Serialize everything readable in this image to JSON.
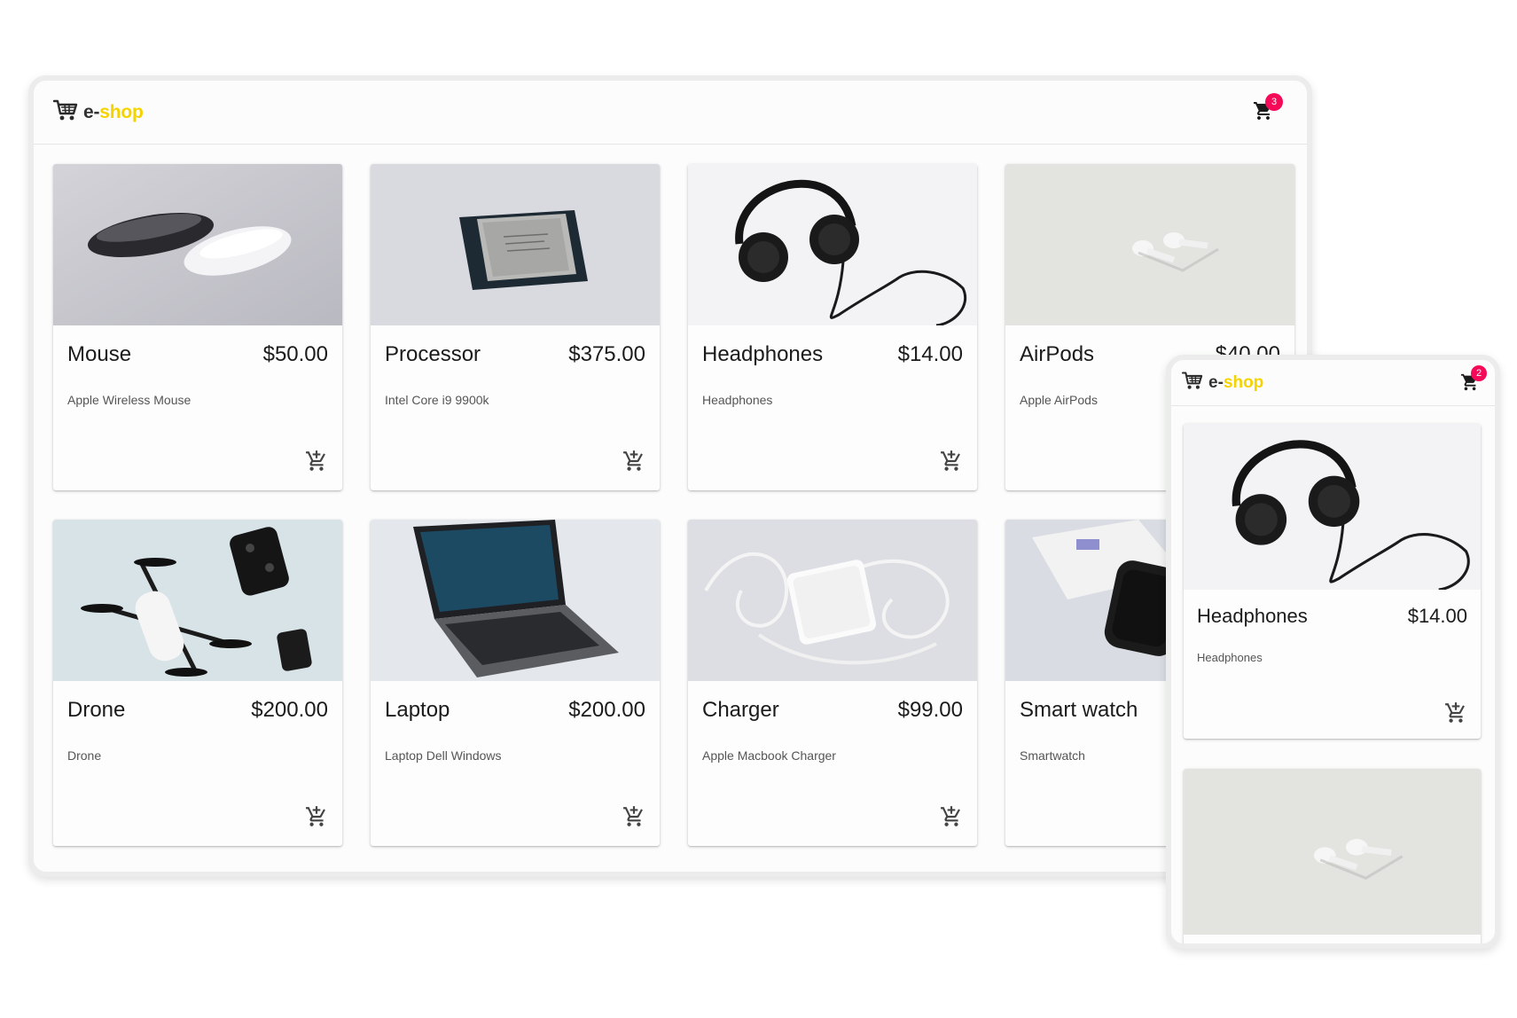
{
  "desktop": {
    "brand": {
      "prefix": "e-",
      "suffix": "shop",
      "icon": "shopping-cart-logo-icon"
    },
    "cart": {
      "icon": "cart-icon",
      "count": "3"
    },
    "products": [
      {
        "name": "Mouse",
        "price": "$50.00",
        "description": "Apple Wireless Mouse",
        "image": "mouse-photo"
      },
      {
        "name": "Processor",
        "price": "$375.00",
        "description": "Intel Core i9 9900k",
        "image": "processor-photo"
      },
      {
        "name": "Headphones",
        "price": "$14.00",
        "description": "Headphones",
        "image": "headphones-photo"
      },
      {
        "name": "AirPods",
        "price": "$40.00",
        "description": "Apple AirPods",
        "image": "airpods-photo"
      },
      {
        "name": "Drone",
        "price": "$200.00",
        "description": "Drone",
        "image": "drone-photo"
      },
      {
        "name": "Laptop",
        "price": "$200.00",
        "description": "Laptop Dell Windows",
        "image": "laptop-photo"
      },
      {
        "name": "Charger",
        "price": "$99.00",
        "description": "Apple Macbook Charger",
        "image": "charger-photo"
      },
      {
        "name": "Smart watch",
        "price": "",
        "description": "Smartwatch",
        "image": "smartwatch-photo"
      }
    ]
  },
  "mobile": {
    "brand": {
      "prefix": "e-",
      "suffix": "shop",
      "icon": "shopping-cart-logo-icon"
    },
    "cart": {
      "icon": "cart-icon",
      "count": "2"
    },
    "products": [
      {
        "name": "Headphones",
        "price": "$14.00",
        "description": "Headphones",
        "image": "headphones-photo"
      },
      {
        "name": "",
        "price": "",
        "description": "",
        "image": "airpods-photo"
      }
    ]
  },
  "colors": {
    "brand_accent": "#f5d300",
    "badge": "#f50a57",
    "card_background": "#fcfdfc",
    "frame_border": "#ececec"
  }
}
